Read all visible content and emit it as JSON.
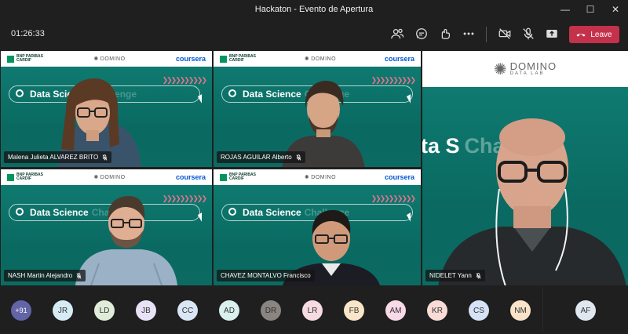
{
  "window": {
    "title": "Hackaton - Evento de Apertura",
    "controls": [
      "—",
      "☐",
      "✕"
    ]
  },
  "meeting": {
    "timer": "01:26:33",
    "toolbar": {
      "icons": [
        "participants-icon",
        "chat-icon",
        "reactions-icon",
        "more-actions-icon",
        "camera-off-icon",
        "mic-off-icon",
        "share-icon"
      ],
      "leave_label": "Leave",
      "leave_color": "#c4314b"
    }
  },
  "tiles": [
    {
      "name": "Malena Julieta ALVAREZ BRITO",
      "banner": {
        "bnp_line1": "BNP PARIBAS",
        "bnp_line2": "CARDIF",
        "domino": "DOMINO",
        "domino_sub": "DATA LAB",
        "coursera": "coursera"
      },
      "slide_text": "Data Science",
      "slide_text_2": "Challenge"
    },
    {
      "name": "ROJAS AGUILAR Alberto",
      "banner": {
        "bnp_line1": "BNP PARIBAS",
        "bnp_line2": "CARDIF",
        "domino": "DOMINO",
        "domino_sub": "DATA LAB",
        "coursera": "coursera"
      },
      "slide_text": "Data Science",
      "slide_text_2": "Challenge"
    },
    {
      "name": "NASH Martin Alejandro",
      "banner": {
        "bnp_line1": "BNP PARIBAS",
        "bnp_line2": "CARDIF",
        "domino": "DOMINO",
        "domino_sub": "DATA LAB",
        "coursera": "coursera"
      },
      "slide_text": "Data Science",
      "slide_text_2": "Challenge"
    },
    {
      "name": "CHAVEZ MONTALVO Francisco",
      "banner": {
        "bnp_line1": "BNP PARIBAS",
        "bnp_line2": "CARDIF",
        "domino": "DOMINO",
        "domino_sub": "DATA LAB",
        "coursera": "coursera"
      },
      "slide_text": "Data Science",
      "slide_text_2": "Challenge"
    }
  ],
  "featured": {
    "name": "NIDELET Yann",
    "logo_line1": "DOMINO",
    "logo_line2": "DATA LAB",
    "slide_text": "ta S",
    "slide_text_2": "Challeng"
  },
  "attendees": {
    "overflow": "+91",
    "initials": [
      "JR",
      "LD",
      "JB",
      "CC",
      "AD",
      "DR",
      "LR",
      "FB",
      "AM",
      "KR",
      "CS",
      "NM",
      "AF"
    ],
    "colors": [
      "#d6ecf4",
      "#dfecd8",
      "#e8e2f6",
      "#d8e6f6",
      "#d9f0ec",
      "#8a8580",
      "#f6dbe2",
      "#f9e6c8",
      "#f7d9e7",
      "#f9dcd6",
      "#d6e2f5",
      "#f9e4c9",
      "#dfe8f1"
    ]
  }
}
